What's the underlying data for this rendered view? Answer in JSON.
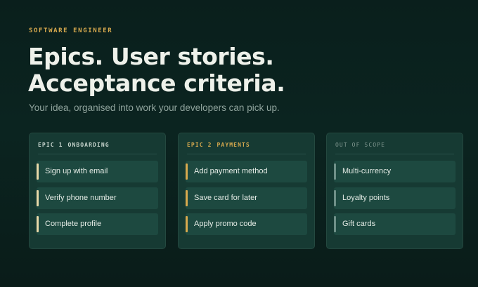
{
  "eyebrow": "SOFTWARE ENGINEER",
  "headline": {
    "line1": "Epics. User stories.",
    "line2": "Acceptance criteria."
  },
  "subhead": "Your idea, organised into work your developers can pick up.",
  "colors": {
    "accent_gold": "#d7a94e",
    "accent_cream": "#e8d8a8",
    "accent_muted": "#6f9088",
    "card_bg": "#163a33",
    "item_bg": "#1d4940",
    "page_bg": "#0b2420"
  },
  "cards": [
    {
      "number": "EPIC 1",
      "title": "ONBOARDING",
      "items": [
        "Sign up with email",
        "Verify phone number",
        "Complete profile"
      ]
    },
    {
      "number": "EPIC 2",
      "title": "PAYMENTS",
      "items": [
        "Add payment method",
        "Save card for later",
        "Apply promo code"
      ]
    },
    {
      "title": "OUT OF SCOPE",
      "items": [
        "Multi-currency",
        "Loyalty points",
        "Gift cards"
      ]
    }
  ]
}
